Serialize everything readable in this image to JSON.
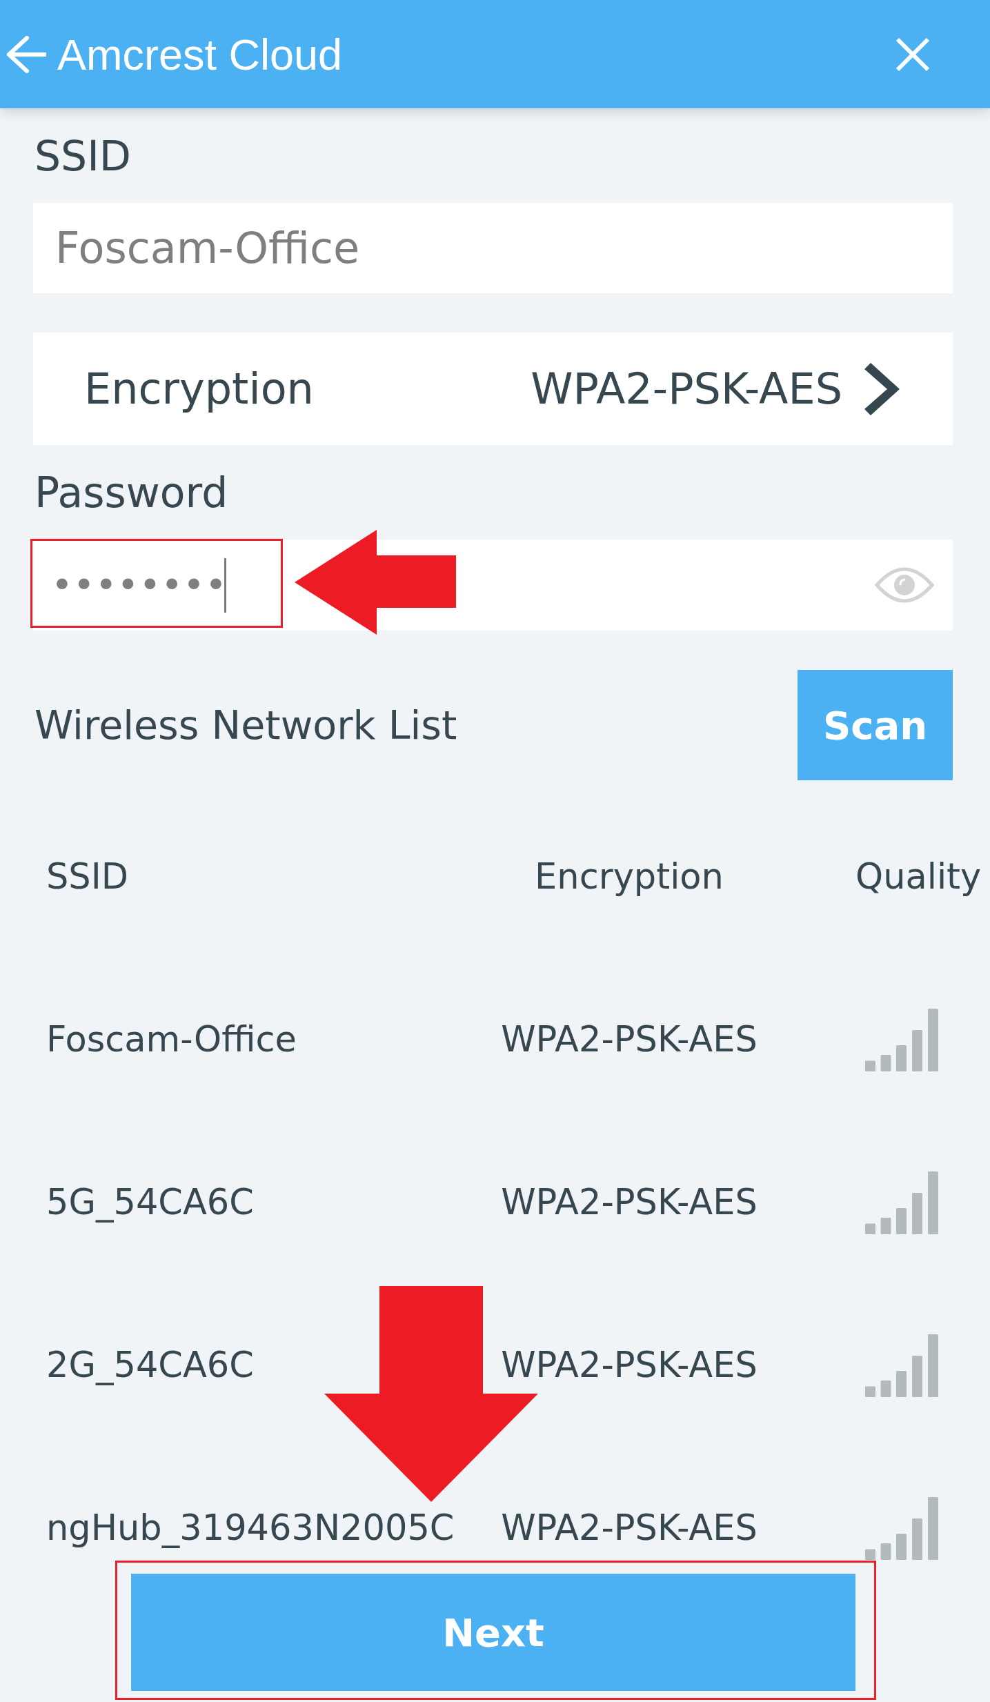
{
  "header": {
    "title": "Amcrest Cloud"
  },
  "ssid": {
    "label": "SSID",
    "value": "Foscam-Office"
  },
  "encryption": {
    "label": "Encryption",
    "value": "WPA2-PSK-AES"
  },
  "password": {
    "label": "Password",
    "value": "••••••••",
    "focused": true
  },
  "network_list": {
    "title": "Wireless Network List",
    "scan_button": "Scan",
    "columns": [
      "SSID",
      "Encryption",
      "Quality"
    ],
    "rows": [
      {
        "ssid": "Foscam-Office",
        "encryption": "WPA2-PSK-AES"
      },
      {
        "ssid": "5G_54CA6C",
        "encryption": "WPA2-PSK-AES"
      },
      {
        "ssid": "2G_54CA6C",
        "encryption": "WPA2-PSK-AES"
      },
      {
        "ssid": "ngHub_319463N2005C",
        "encryption": "WPA2-PSK-AES"
      }
    ]
  },
  "next_button": "Next"
}
